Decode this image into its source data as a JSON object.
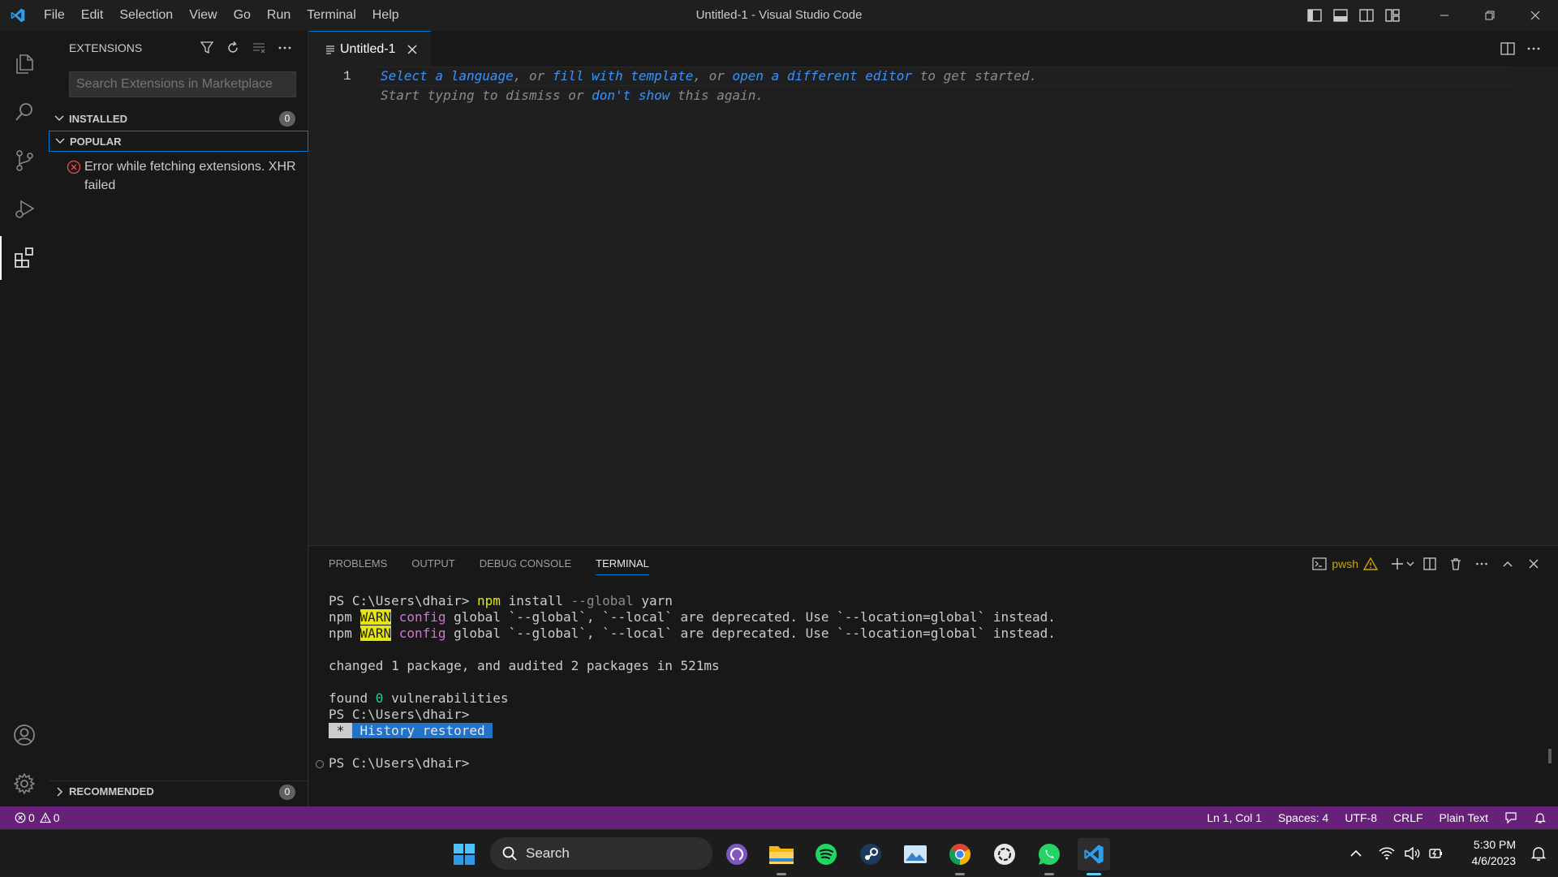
{
  "window": {
    "title": "Untitled-1 - Visual Studio Code",
    "menu": [
      "File",
      "Edit",
      "Selection",
      "View",
      "Go",
      "Run",
      "Terminal",
      "Help"
    ]
  },
  "activity_bar": {
    "items": [
      "files-icon",
      "search-icon",
      "source-control-icon",
      "run-debug-icon",
      "extensions-icon"
    ],
    "bottom": [
      "accounts-icon",
      "manage-gear-icon"
    ],
    "active": "extensions-icon"
  },
  "sidebar": {
    "title": "EXTENSIONS",
    "search_placeholder": "Search Extensions in Marketplace",
    "sections": {
      "installed": {
        "label": "INSTALLED",
        "count": "0"
      },
      "popular": {
        "label": "POPULAR"
      },
      "recommended": {
        "label": "RECOMMENDED",
        "count": "0"
      }
    },
    "error": "Error while fetching extensions. XHR failed"
  },
  "editor": {
    "tab_label": "Untitled-1",
    "line_number": "1",
    "hint": {
      "select_language": "Select a language",
      "or1": ", or ",
      "fill_template": "fill with template",
      "or2": ", or ",
      "open_editor": "open a different editor",
      "tail1": " to get started.",
      "start_typing": "Start typing to dismiss or ",
      "dont_show": "don't show",
      "tail2": " this again."
    }
  },
  "panel": {
    "tabs": [
      "PROBLEMS",
      "OUTPUT",
      "DEBUG CONSOLE",
      "TERMINAL"
    ],
    "active_tab": "TERMINAL",
    "shell": "pwsh",
    "terminal": {
      "prompt": "PS C:\\Users\\dhair> ",
      "cmd_npm": "npm",
      "cmd_install": " install ",
      "cmd_flag": "--global",
      "cmd_pkg": " yarn",
      "warn_npm": "npm",
      "warn_tag": "WARN",
      "warn_config": "config",
      "warn_msg": " global `--global`, `--local` are deprecated. Use `--location=global` instead.",
      "changed": "changed 1 package, and audited 2 packages in 521ms",
      "found_pre": "found ",
      "found_num": "0",
      "found_post": " vulnerabilities",
      "prompt2": "PS C:\\Users\\dhair>",
      "history_star": " * ",
      "history_text": " History restored ",
      "prompt3": "PS C:\\Users\\dhair>"
    }
  },
  "status_bar": {
    "errors": "0",
    "warnings": "0",
    "position": "Ln 1, Col 1",
    "spaces": "Spaces: 4",
    "encoding": "UTF-8",
    "eol": "CRLF",
    "language": "Plain Text",
    "color": "#68217a"
  },
  "taskbar": {
    "search_label": "Search",
    "apps": [
      "windows-start-icon",
      "github-desktop-icon",
      "file-explorer-icon",
      "spotify-icon",
      "steam-icon",
      "photos-icon",
      "chrome-icon",
      "chatgpt-icon",
      "whatsapp-icon",
      "vscode-icon"
    ],
    "time": "5:30 PM",
    "date": "4/6/2023"
  }
}
